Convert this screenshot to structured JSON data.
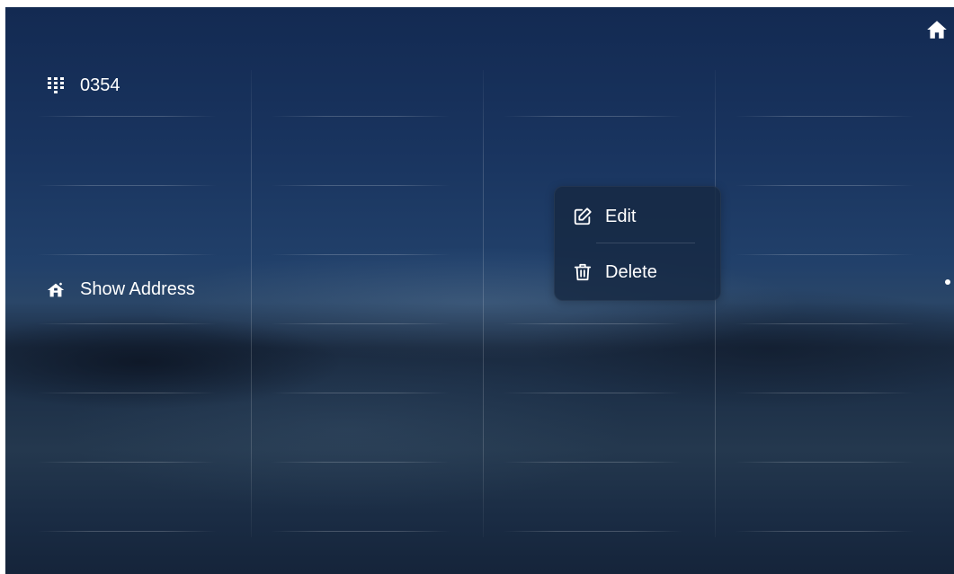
{
  "screen": {
    "room_number": "0354",
    "show_address_label": "Show Address"
  },
  "context_menu": {
    "edit_label": "Edit",
    "delete_label": "Delete"
  },
  "icons": {
    "home": "home-icon",
    "dialpad": "dialpad-icon",
    "address": "address-house-icon",
    "edit": "edit-icon",
    "delete": "trash-icon"
  },
  "colors": {
    "text": "#ffffff",
    "menu_background": "#162842"
  }
}
